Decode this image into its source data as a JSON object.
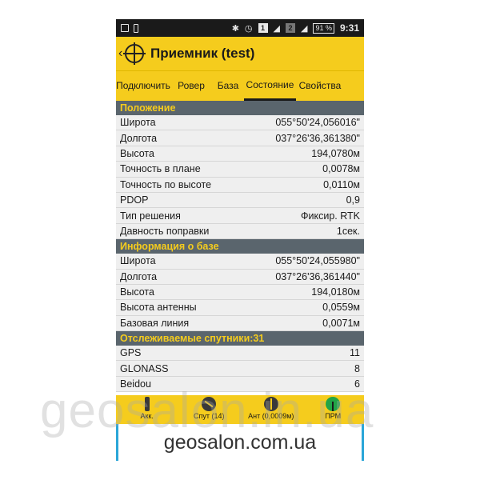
{
  "statusbar": {
    "battery": "91 %",
    "time": "9:31",
    "sim1": "1",
    "sim2": "2"
  },
  "appbar": {
    "back_icon": "chevron-left-icon",
    "title": "Приемник (test)"
  },
  "tabs": [
    {
      "label": "Подключить"
    },
    {
      "label": "Ровер"
    },
    {
      "label": "База"
    },
    {
      "label": "Состояние",
      "active": true
    },
    {
      "label": "Свойства"
    }
  ],
  "sections": [
    {
      "title": "Положение",
      "rows": [
        {
          "label": "Широта",
          "value": "055°50'24,056016\""
        },
        {
          "label": "Долгота",
          "value": "037°26'36,361380\""
        },
        {
          "label": "Высота",
          "value": "194,0780м"
        },
        {
          "label": "Точность в плане",
          "value": "0,0078м"
        },
        {
          "label": "Точность по высоте",
          "value": "0,0110м"
        },
        {
          "label": "PDOP",
          "value": "0,9"
        },
        {
          "label": "Тип решения",
          "value": "Фиксир. RTK"
        },
        {
          "label": "Давность поправки",
          "value": "1сек."
        }
      ]
    },
    {
      "title": "Информация о базе",
      "rows": [
        {
          "label": "Широта",
          "value": "055°50'24,055980\""
        },
        {
          "label": "Долгота",
          "value": "037°26'36,361440\""
        },
        {
          "label": "Высота",
          "value": "194,0180м"
        },
        {
          "label": "Высота антенны",
          "value": "0,0559м"
        },
        {
          "label": "Базовая линия",
          "value": "0,0071м"
        }
      ]
    },
    {
      "title": "Отслеживаемые спутники:31",
      "rows": [
        {
          "label": "GPS",
          "value": "11"
        },
        {
          "label": "GLONASS",
          "value": "8"
        },
        {
          "label": "Beidou",
          "value": "6"
        }
      ]
    }
  ],
  "bottombar": [
    {
      "label": "Акк.",
      "icon": "battery-icon"
    },
    {
      "label": "Спут (14)",
      "icon": "satellite-icon"
    },
    {
      "label": "Ант (0,0009м)",
      "icon": "antenna-pole-icon"
    },
    {
      "label": "ПРМ",
      "icon": "rtk-receiver-icon"
    }
  ],
  "ad": {
    "text": "geosalon.com.ua"
  },
  "watermark": {
    "text": "geosalon.in.ua"
  },
  "colors": {
    "accent": "#f5cc1d",
    "section_bg": "#5a656d",
    "row_bg": "#efefef",
    "ad_border": "#2aa6d8"
  }
}
